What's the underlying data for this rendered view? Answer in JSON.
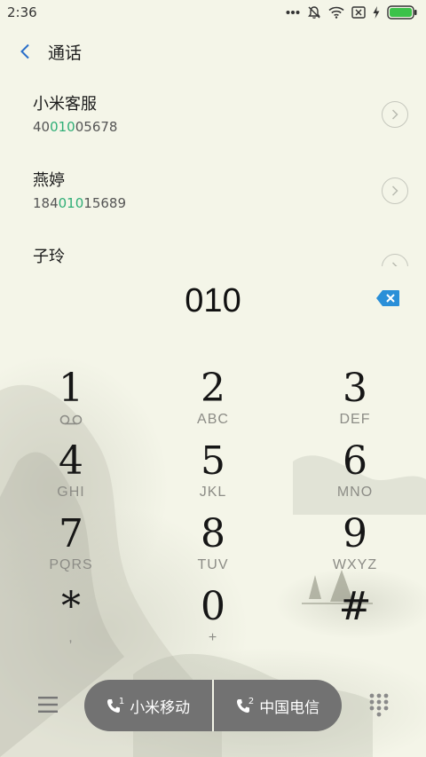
{
  "status_bar": {
    "time": "2:36",
    "icons": [
      "more-dots-icon",
      "silent-bell-icon",
      "wifi-icon",
      "no-sim-icon",
      "charging-icon",
      "battery-icon"
    ]
  },
  "header": {
    "back_icon": "chevron-left-icon",
    "title": "通话"
  },
  "contacts": [
    {
      "name": "小米客服",
      "number_before": "40",
      "number_match": "010",
      "number_after": "05678"
    },
    {
      "name": "燕婷",
      "number_before": "184",
      "number_match": "010",
      "number_after": "15689"
    },
    {
      "name": "子玲",
      "number_before": "",
      "number_match": "",
      "number_after": ""
    }
  ],
  "dialer": {
    "input": "010",
    "backspace_icon": "backspace-icon",
    "keys": [
      [
        {
          "digit": "1",
          "sub": ""
        },
        {
          "digit": "2",
          "sub": "ABC"
        },
        {
          "digit": "3",
          "sub": "DEF"
        }
      ],
      [
        {
          "digit": "4",
          "sub": "GHI"
        },
        {
          "digit": "5",
          "sub": "JKL"
        },
        {
          "digit": "6",
          "sub": "MNO"
        }
      ],
      [
        {
          "digit": "7",
          "sub": "PQRS"
        },
        {
          "digit": "8",
          "sub": "TUV"
        },
        {
          "digit": "9",
          "sub": "WXYZ"
        }
      ],
      [
        {
          "digit": "*",
          "sub": ","
        },
        {
          "digit": "0",
          "sub": "+"
        },
        {
          "digit": "#",
          "sub": ""
        }
      ]
    ],
    "voicemail_icon": "voicemail-icon"
  },
  "bottom_bar": {
    "menu_icon": "menu-icon",
    "sim1_label": "小米移动",
    "sim1_index": "1",
    "sim2_label": "中国电信",
    "sim2_index": "2",
    "dialpad_icon": "dialpad-icon"
  },
  "colors": {
    "background": "#f4f5e8",
    "accent_blue": "#2a8fd8",
    "match_green": "#2fae76",
    "call_button": "#727272"
  }
}
